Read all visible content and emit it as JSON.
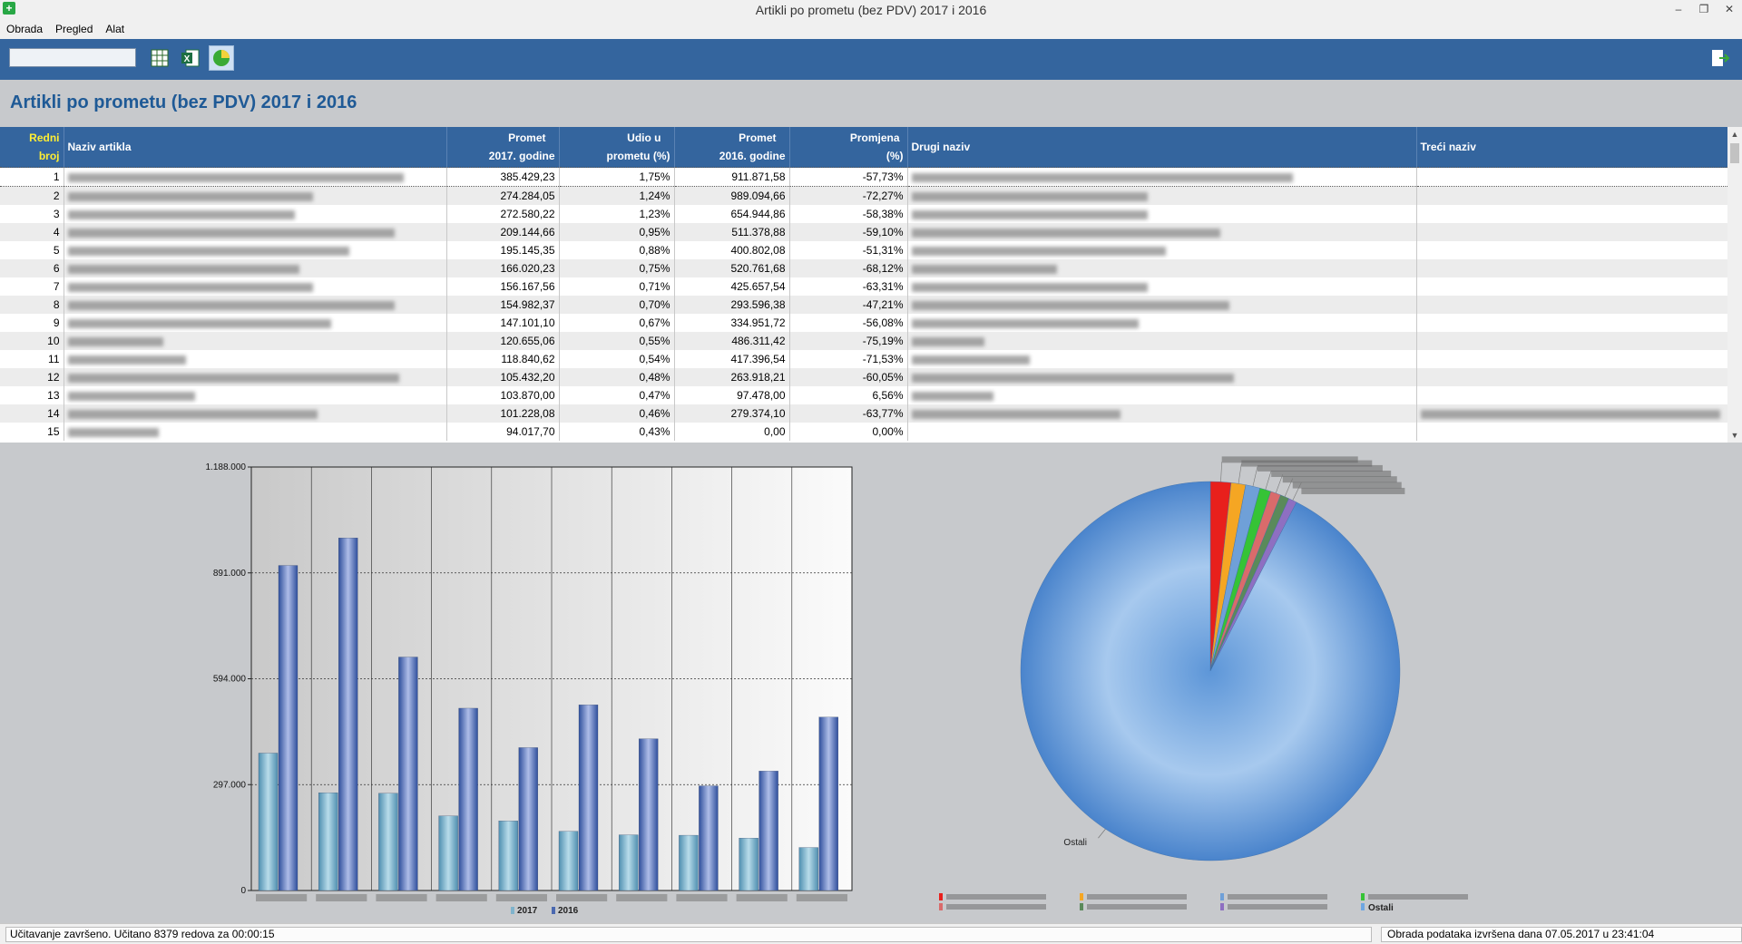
{
  "window": {
    "title": "Artikli po prometu (bez PDV) 2017 i 2016",
    "app_icon_glyph": "+"
  },
  "menu": [
    "Obrada",
    "Pregled",
    "Alat"
  ],
  "toolbar": {
    "search_value": "",
    "icons": [
      "grid-icon",
      "excel-icon",
      "pie-chart-icon",
      "exit-icon"
    ]
  },
  "page_title": "Artikli po prometu (bez PDV) 2017 i 2016",
  "table": {
    "columns": {
      "redni_1": "Redni",
      "redni_2": "broj",
      "naziv": "Naziv artikla",
      "p2017_1": "Promet",
      "p2017_2": "2017. godine",
      "udio_1": "Udio u",
      "udio_2": "prometu (%)",
      "p2016_1": "Promet",
      "p2016_2": "2016. godine",
      "promjena_1": "Promjena",
      "promjena_2": "(%)",
      "drugi": "Drugi naziv",
      "treci": "Treći naziv"
    },
    "rows": [
      {
        "n": "1",
        "p2017": "385.429,23",
        "udio": "1,75%",
        "p2016": "911.871,58",
        "promjena": "-57,73%"
      },
      {
        "n": "2",
        "p2017": "274.284,05",
        "udio": "1,24%",
        "p2016": "989.094,66",
        "promjena": "-72,27%"
      },
      {
        "n": "3",
        "p2017": "272.580,22",
        "udio": "1,23%",
        "p2016": "654.944,86",
        "promjena": "-58,38%"
      },
      {
        "n": "4",
        "p2017": "209.144,66",
        "udio": "0,95%",
        "p2016": "511.378,88",
        "promjena": "-59,10%"
      },
      {
        "n": "5",
        "p2017": "195.145,35",
        "udio": "0,88%",
        "p2016": "400.802,08",
        "promjena": "-51,31%"
      },
      {
        "n": "6",
        "p2017": "166.020,23",
        "udio": "0,75%",
        "p2016": "520.761,68",
        "promjena": "-68,12%"
      },
      {
        "n": "7",
        "p2017": "156.167,56",
        "udio": "0,71%",
        "p2016": "425.657,54",
        "promjena": "-63,31%"
      },
      {
        "n": "8",
        "p2017": "154.982,37",
        "udio": "0,70%",
        "p2016": "293.596,38",
        "promjena": "-47,21%"
      },
      {
        "n": "9",
        "p2017": "147.101,10",
        "udio": "0,67%",
        "p2016": "334.951,72",
        "promjena": "-56,08%"
      },
      {
        "n": "10",
        "p2017": "120.655,06",
        "udio": "0,55%",
        "p2016": "486.311,42",
        "promjena": "-75,19%"
      },
      {
        "n": "11",
        "p2017": "118.840,62",
        "udio": "0,54%",
        "p2016": "417.396,54",
        "promjena": "-71,53%"
      },
      {
        "n": "12",
        "p2017": "105.432,20",
        "udio": "0,48%",
        "p2016": "263.918,21",
        "promjena": "-60,05%"
      },
      {
        "n": "13",
        "p2017": "103.870,00",
        "udio": "0,47%",
        "p2016": "97.478,00",
        "promjena": "6,56%"
      },
      {
        "n": "14",
        "p2017": "101.228,08",
        "udio": "0,46%",
        "p2016": "279.374,10",
        "promjena": "-63,77%"
      },
      {
        "n": "15",
        "p2017": "94.017,70",
        "udio": "0,43%",
        "p2016": "0,00",
        "promjena": "0,00%"
      }
    ]
  },
  "chart_data": [
    {
      "type": "bar",
      "categories": [
        "",
        "",
        "",
        "",
        "",
        "",
        "",
        "",
        "",
        ""
      ],
      "series": [
        {
          "name": "2017",
          "values": [
            385429,
            274284,
            272580,
            209145,
            195145,
            166020,
            156168,
            154982,
            147101,
            120655
          ]
        },
        {
          "name": "2016",
          "values": [
            911872,
            989095,
            654945,
            511379,
            400802,
            520762,
            425658,
            293596,
            334952,
            486311
          ]
        }
      ],
      "y_ticks": [
        "0",
        "297.000",
        "594.000",
        "891.000",
        "1.188.000"
      ],
      "ylim": [
        0,
        1188000
      ],
      "grid": true,
      "legend": "bottom",
      "colors": {
        "2017": "#7fb3cc",
        "2016": "#4a68b0"
      }
    },
    {
      "type": "pie",
      "labels": [
        "",
        "",
        "",
        "",
        "",
        "",
        "",
        "Ostali"
      ],
      "values": [
        1.75,
        1.24,
        1.23,
        0.95,
        0.88,
        0.75,
        0.71,
        92.49
      ],
      "colors": [
        "#e8201c",
        "#f5a623",
        "#6fa0d8",
        "#36c336",
        "#d96b6b",
        "#5a8a5a",
        "#8e6fc1",
        "#6ea6e2"
      ],
      "legend": "bottom",
      "legend_items": [
        "",
        "",
        "",
        "",
        "",
        "",
        "",
        "Ostali"
      ]
    }
  ],
  "status": {
    "left": "Učitavanje završeno. Učitano 8379 redova za 00:00:15",
    "right": "Obrada podataka izvršena dana 07.05.2017 u 23:41:04"
  }
}
